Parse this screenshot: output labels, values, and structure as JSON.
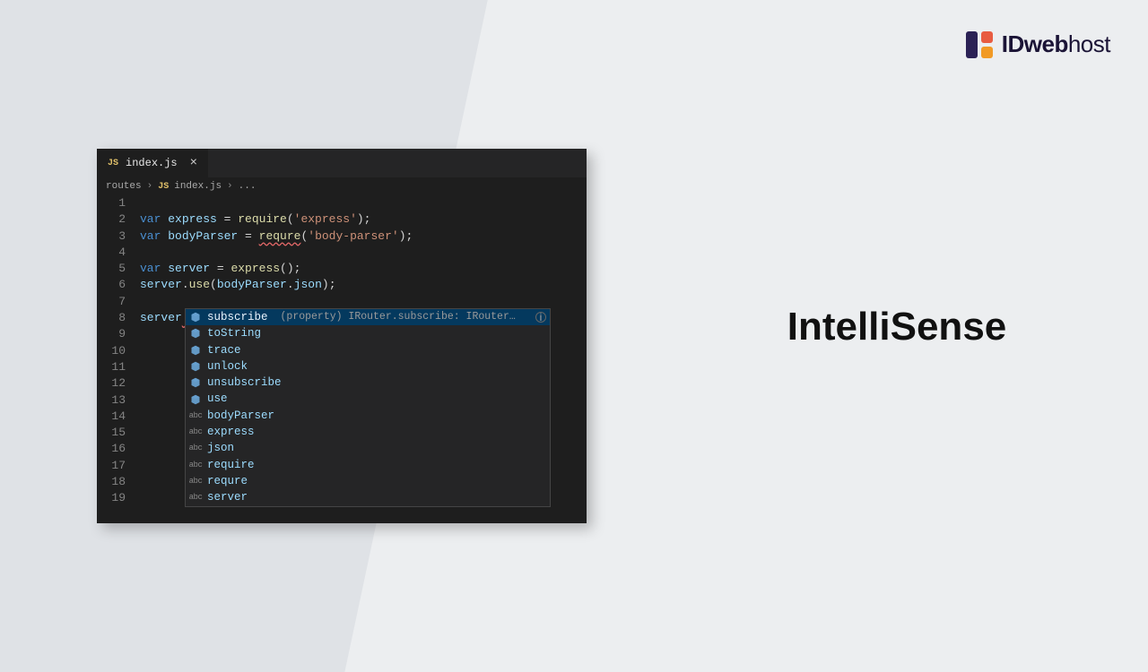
{
  "brand": {
    "name_bold": "IDweb",
    "name_light": "host"
  },
  "page_title": "IntelliSense",
  "editor": {
    "tab": {
      "icon": "JS",
      "filename": "index.js"
    },
    "breadcrumb": {
      "folder": "routes",
      "icon": "JS",
      "file": "index.js",
      "rest": "..."
    },
    "lines": [
      "1",
      "2",
      "3",
      "4",
      "5",
      "6",
      "7",
      "8",
      "9",
      "10",
      "11",
      "12",
      "13",
      "14",
      "15",
      "16",
      "17",
      "18",
      "19"
    ],
    "code": {
      "l1_kw": "var",
      "l1_id": "express",
      "l1_eq": " = ",
      "l1_fn": "require",
      "l1_open": "(",
      "l1_str": "'express'",
      "l1_close": ");",
      "l2_kw": "var",
      "l2_id": "bodyParser",
      "l2_eq": " = ",
      "l2_fn": "requre",
      "l2_open": "(",
      "l2_str": "'body-parser'",
      "l2_close": ");",
      "l4_kw": "var",
      "l4_id": "server",
      "l4_eq": " = ",
      "l4_fn": "express",
      "l4_call": "();",
      "l5_obj": "server",
      "l5_dot": ".",
      "l5_fn": "use",
      "l5_open": "(",
      "l5_arg1": "bodyParser",
      "l5_dot2": ".",
      "l5_arg2": "json",
      "l5_close": ");",
      "l7_obj": "server",
      "l7_dot": "."
    },
    "suggest": {
      "detail": "(property) IRouter.subscribe: IRouter…",
      "items": [
        {
          "icon": "method",
          "label": "subscribe",
          "selected": true
        },
        {
          "icon": "method",
          "label": "toString"
        },
        {
          "icon": "method",
          "label": "trace"
        },
        {
          "icon": "method",
          "label": "unlock"
        },
        {
          "icon": "method",
          "label": "unsubscribe"
        },
        {
          "icon": "method",
          "label": "use"
        },
        {
          "icon": "abc",
          "label": "bodyParser"
        },
        {
          "icon": "abc",
          "label": "express"
        },
        {
          "icon": "abc",
          "label": "json"
        },
        {
          "icon": "abc",
          "label": "require"
        },
        {
          "icon": "abc",
          "label": "requre"
        },
        {
          "icon": "abc",
          "label": "server"
        }
      ]
    }
  }
}
